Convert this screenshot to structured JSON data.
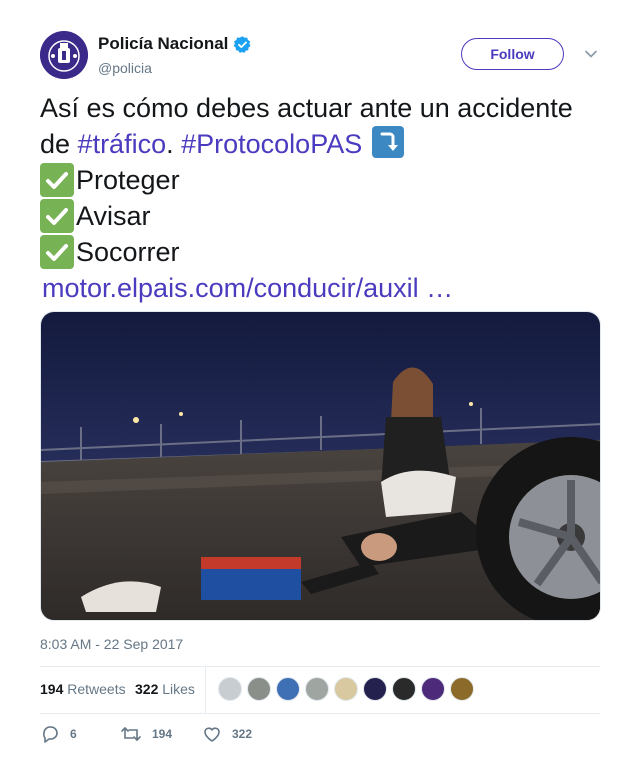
{
  "account": {
    "display_name": "Policía Nacional",
    "handle": "@policia",
    "verified": true
  },
  "follow_label": "Follow",
  "tweet": {
    "line1": "Así es cómo debes actuar ante un accidente",
    "line2_prefix": "de ",
    "hashtag1": "#tráfico",
    "line2_mid": ". ",
    "hashtag2": "#ProtocoloPAS",
    "items": [
      "Proteger",
      "Avisar",
      "Socorrer"
    ],
    "link": "motor.elpais.com/conducir/auxil …"
  },
  "timestamp": "8:03 AM - 22 Sep 2017",
  "stats": {
    "retweets_count": "194",
    "retweets_label": "Retweets",
    "likes_count": "322",
    "likes_label": "Likes"
  },
  "actions": {
    "reply_count": "6",
    "retweet_count": "194",
    "like_count": "322"
  },
  "colors": {
    "accent": "#4a3bbf",
    "check_green": "#77b255",
    "muted": "#657786"
  }
}
